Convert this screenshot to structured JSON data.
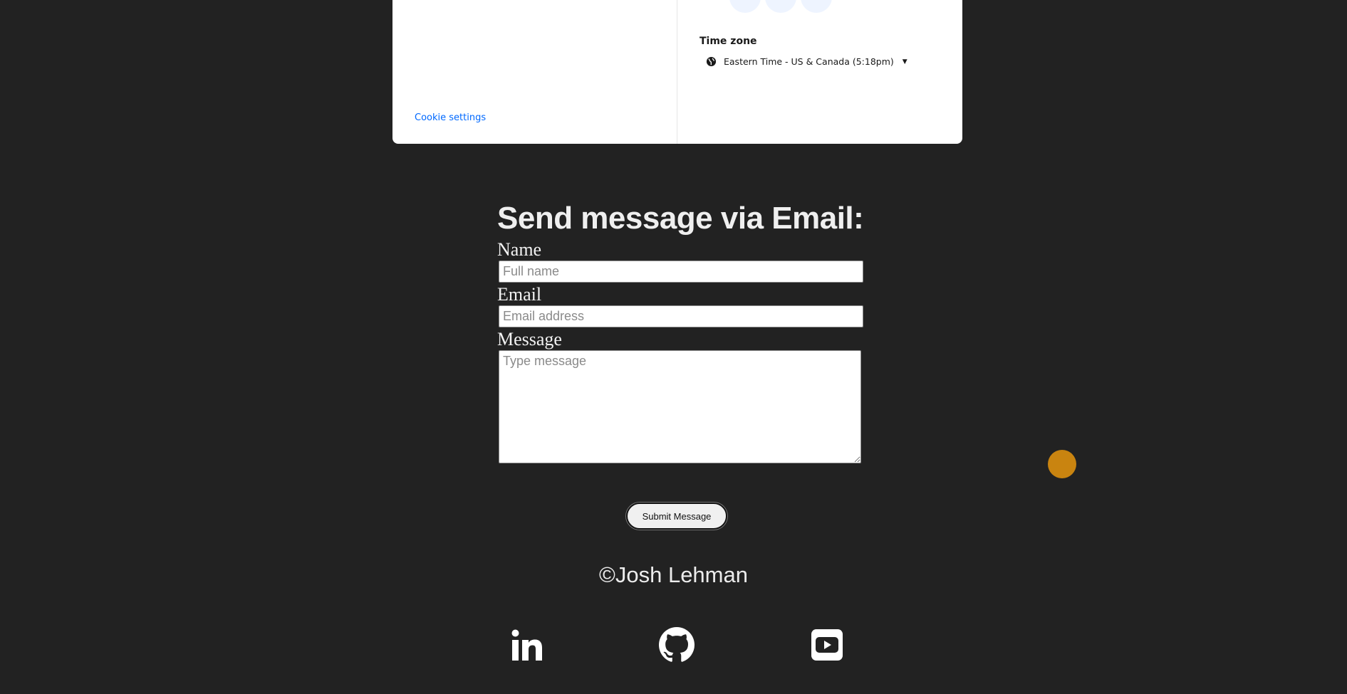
{
  "calendly": {
    "cookie_settings": "Cookie settings",
    "timezone_title": "Time zone",
    "timezone_value": "Eastern Time - US & Canada (5:18pm)"
  },
  "email_form": {
    "title": "Send message via Email:",
    "name_label": "Name",
    "name_placeholder": "Full name",
    "email_label": "Email",
    "email_placeholder": "Email address",
    "message_label": "Message",
    "message_placeholder": "Type message",
    "submit_label": "Submit Message"
  },
  "footer": {
    "copyright": "©Josh Lehman",
    "social_icons": [
      "linkedin-icon",
      "github-icon",
      "youtube-icon"
    ]
  },
  "colors": {
    "background": "#222222",
    "accent_dot": "#c98410",
    "link_blue": "#0069ff"
  }
}
